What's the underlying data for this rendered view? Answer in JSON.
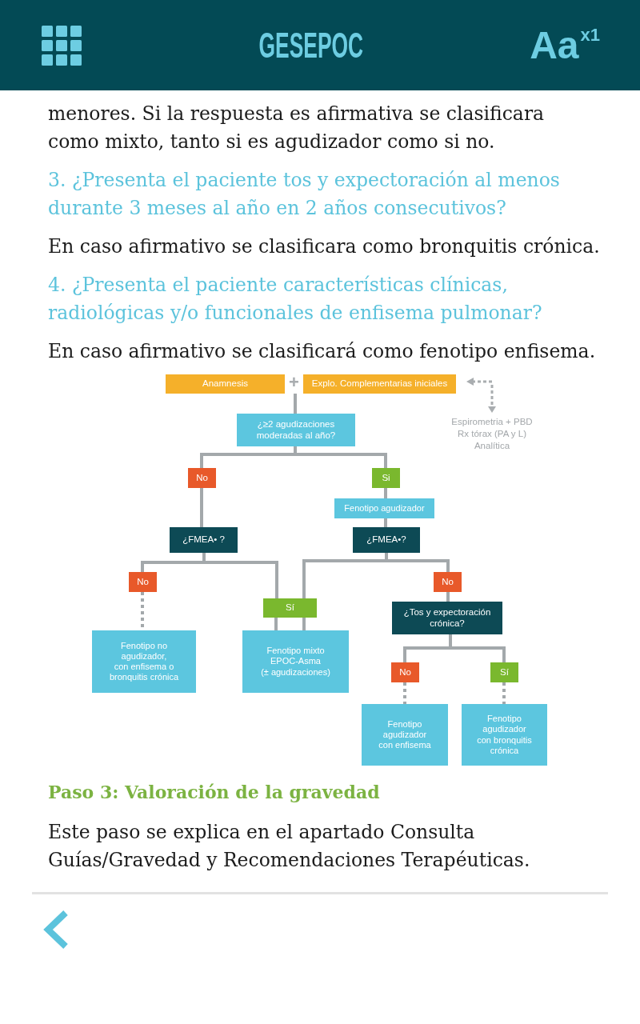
{
  "header": {
    "title": "GESEPOC",
    "font_size_button": {
      "label": "Aa",
      "multiplier": "x1"
    }
  },
  "content": [
    {
      "kind": "paragraph",
      "text": "menores. Si la respuesta es afirmativa se clasificara como mixto, tanto si es agudizador como si no."
    },
    {
      "kind": "question",
      "text": "3. ¿Presenta el paciente tos y expectoración al menos durante 3 meses al año en 2 años consecutivos?"
    },
    {
      "kind": "paragraph",
      "text": "En caso afirmativo se clasificara como bronquitis crónica."
    },
    {
      "kind": "question",
      "text": "4. ¿Presenta el paciente características clínicas, radiológicas y/o funcionales de enfisema pulmonar?"
    },
    {
      "kind": "paragraph",
      "text": "En caso afirmativo se clasificará como fenotipo enfisema."
    },
    {
      "kind": "diagram",
      "plus": "+",
      "note": [
        "Espirometria + PBD",
        "Rx tórax (PA y L)",
        "Analítica"
      ],
      "nodes": [
        {
          "kind": "input",
          "label": "Anamnesis"
        },
        {
          "kind": "input",
          "label": "Explo. Complementarias iniciales"
        },
        {
          "kind": "question",
          "label": "¿≥2 agudizaciones\nmoderadas al año?"
        },
        {
          "kind": "no",
          "label": "No"
        },
        {
          "kind": "yes",
          "label": "Si"
        },
        {
          "kind": "result",
          "label": "Fenotipo agudizador"
        },
        {
          "kind": "decision",
          "label": "¿FMEA• ?"
        },
        {
          "kind": "decision",
          "label": "¿FMEA•?"
        },
        {
          "kind": "no",
          "label": "No"
        },
        {
          "kind": "no",
          "label": "No"
        },
        {
          "kind": "yes",
          "label": "Sí"
        },
        {
          "kind": "decision",
          "label": "¿Tos y expectoración\ncrónica?"
        },
        {
          "kind": "result",
          "label": "Fenotipo no\nagudizador,\ncon enfisema o\nbronquitis crónica"
        },
        {
          "kind": "result",
          "label": "Fenotipo mixto\nEPOC-Asma\n(± agudizaciones)"
        },
        {
          "kind": "no",
          "label": "No"
        },
        {
          "kind": "yes",
          "label": "Sí"
        },
        {
          "kind": "result",
          "label": "Fenotipo\nagudizador\ncon enfisema"
        },
        {
          "kind": "result",
          "label": "Fenotipo\nagudizador\ncon bronquitis\ncrónica"
        }
      ]
    },
    {
      "kind": "heading",
      "text": "Paso 3: Valoración de la gravedad"
    },
    {
      "kind": "paragraph",
      "text": "Este paso se explica en el apartado Consulta Guías/Gravedad y Recomendaciones Terapéuticas."
    }
  ]
}
